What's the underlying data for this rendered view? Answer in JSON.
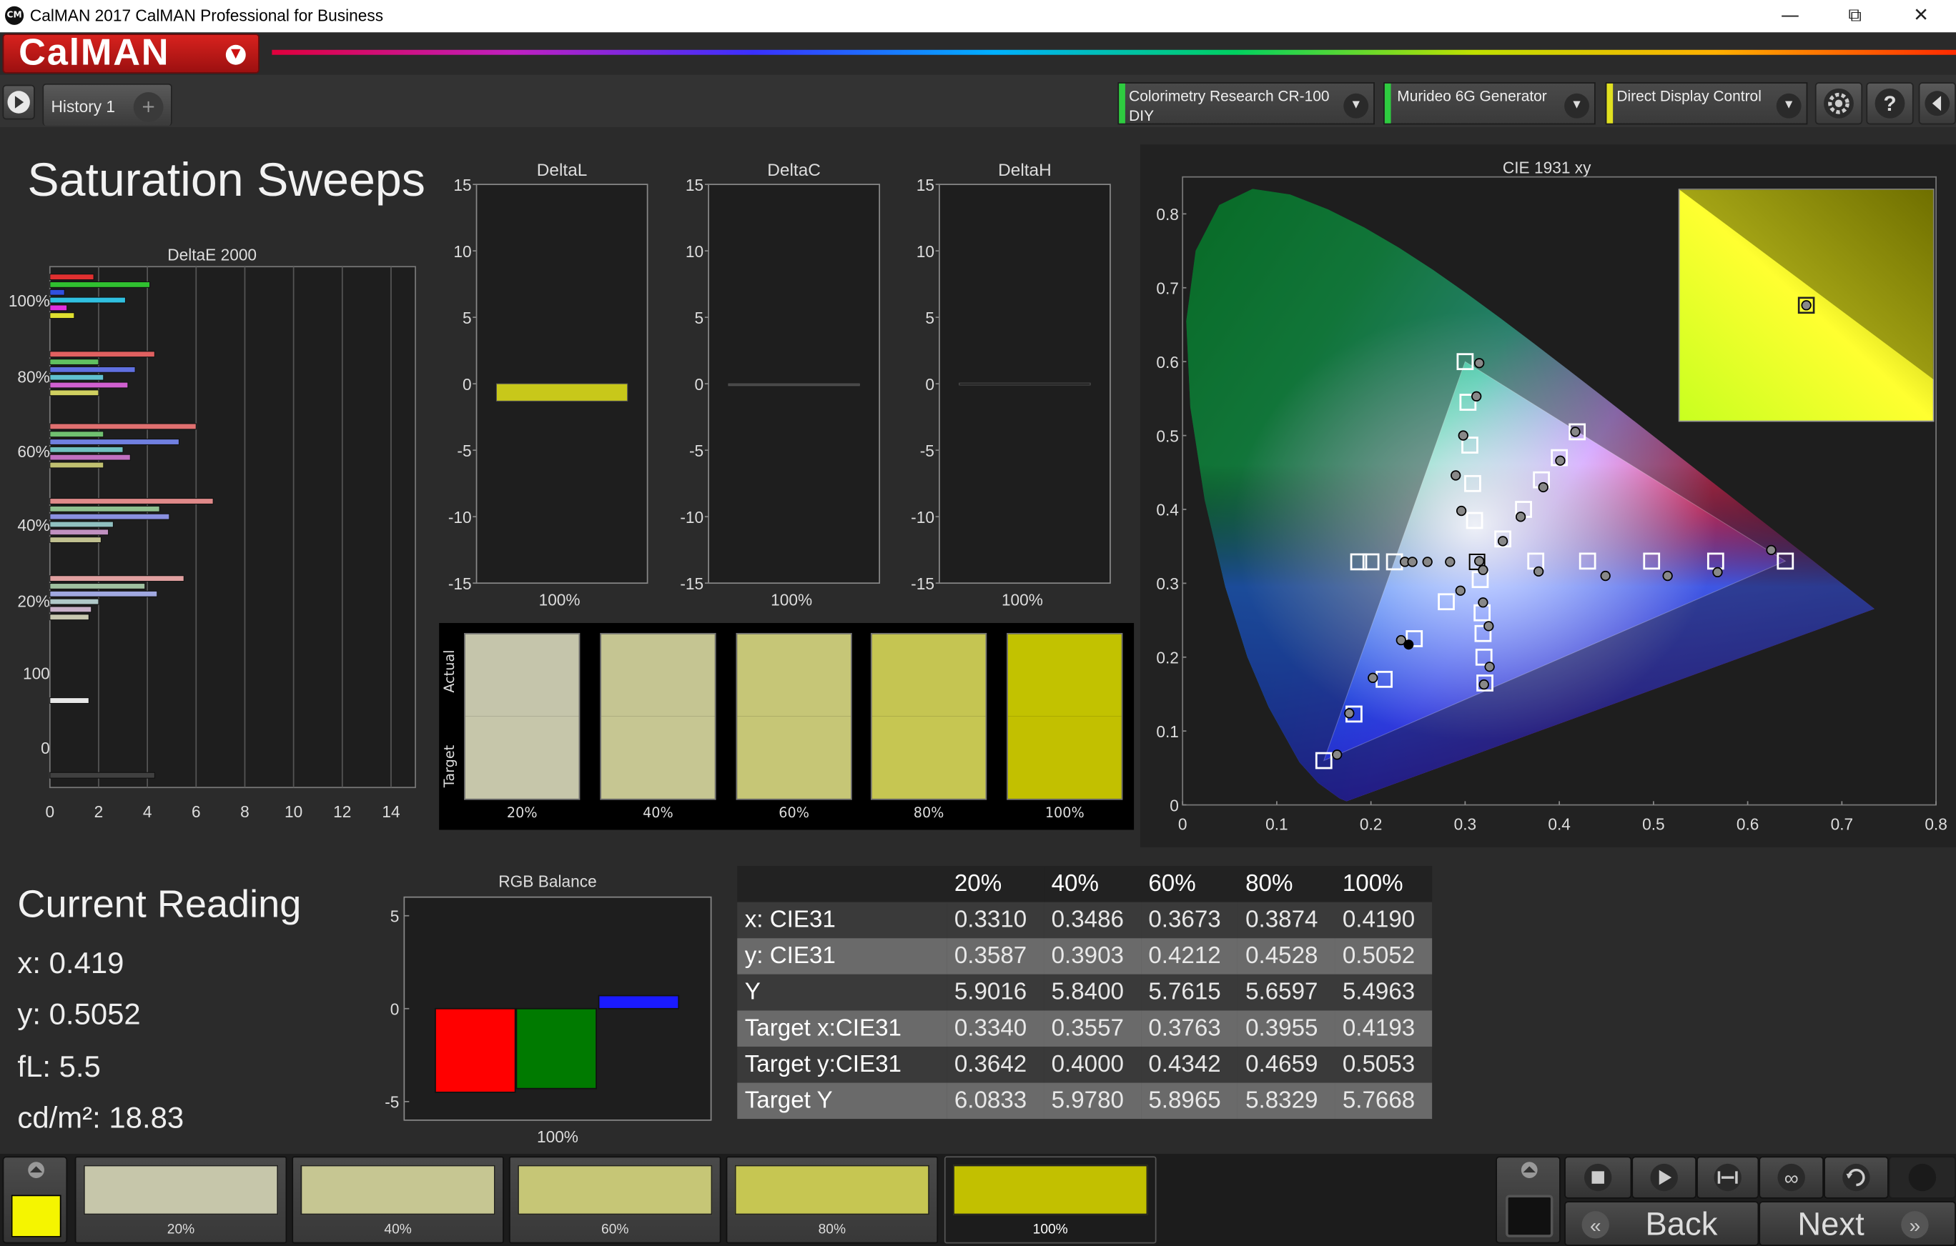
{
  "window": {
    "title": "CalMAN 2017 CalMAN Professional for Business",
    "app_icon": "CM"
  },
  "brand": {
    "logo": "CalMAN"
  },
  "tabs": [
    {
      "label": "History 1"
    }
  ],
  "devices": [
    {
      "label_line1": "Colorimetry Research CR-100",
      "label_line2": "DIY",
      "status_color": "#2ecc40"
    },
    {
      "label_line1": "Murideo 6G Generator",
      "label_line2": "",
      "status_color": "#2ecc40"
    },
    {
      "label_line1": "Direct Display Control",
      "label_line2": "",
      "status_color": "#e0e020"
    }
  ],
  "page": {
    "title": "Saturation Sweeps"
  },
  "deltae": {
    "title": "DeltaE 2000",
    "y_ticks": [
      "100%",
      "80%",
      "60%",
      "40%",
      "20%",
      "100",
      "0"
    ],
    "x_ticks": [
      "0",
      "2",
      "4",
      "6",
      "8",
      "10",
      "12",
      "14"
    ],
    "xlim": [
      0,
      15
    ],
    "groups": [
      {
        "label": "100%",
        "bars": [
          {
            "color": "#e03030",
            "value": 1.8
          },
          {
            "color": "#30c030",
            "value": 4.1
          },
          {
            "color": "#3050e0",
            "value": 0.6
          },
          {
            "color": "#30c0e0",
            "value": 3.1
          },
          {
            "color": "#e030e0",
            "value": 0.7
          },
          {
            "color": "#e0e030",
            "value": 1.0
          }
        ]
      },
      {
        "label": "80%",
        "bars": [
          {
            "color": "#e06060",
            "value": 4.3
          },
          {
            "color": "#60c060",
            "value": 2.0
          },
          {
            "color": "#6070e0",
            "value": 3.5
          },
          {
            "color": "#60c0d0",
            "value": 2.2
          },
          {
            "color": "#d060d0",
            "value": 3.2
          },
          {
            "color": "#d0d060",
            "value": 2.0
          }
        ]
      },
      {
        "label": "60%",
        "bars": [
          {
            "color": "#e07070",
            "value": 6.0
          },
          {
            "color": "#70c070",
            "value": 2.2
          },
          {
            "color": "#7080e0",
            "value": 5.3
          },
          {
            "color": "#70c0c0",
            "value": 3.0
          },
          {
            "color": "#c070c0",
            "value": 3.3
          },
          {
            "color": "#c0c070",
            "value": 2.2
          }
        ]
      },
      {
        "label": "40%",
        "bars": [
          {
            "color": "#e08a8a",
            "value": 6.7
          },
          {
            "color": "#90c090",
            "value": 4.5
          },
          {
            "color": "#8a90e0",
            "value": 4.9
          },
          {
            "color": "#90c0c0",
            "value": 2.6
          },
          {
            "color": "#c090c0",
            "value": 2.4
          },
          {
            "color": "#c0c090",
            "value": 2.1
          }
        ]
      },
      {
        "label": "20%",
        "bars": [
          {
            "color": "#e0a0a0",
            "value": 5.5
          },
          {
            "color": "#a0c0a0",
            "value": 3.9
          },
          {
            "color": "#a0a8e0",
            "value": 4.4
          },
          {
            "color": "#b0c8c8",
            "value": 2.0
          },
          {
            "color": "#c8b0c8",
            "value": 1.7
          },
          {
            "color": "#c8c8b0",
            "value": 1.6
          }
        ]
      },
      {
        "label": "100",
        "bars": [
          {
            "color": "#e8e8e8",
            "value": 1.6
          }
        ]
      },
      {
        "label": "0",
        "bars": [
          {
            "color": "#404040",
            "value": 4.3
          }
        ]
      }
    ]
  },
  "delta_charts": [
    {
      "title": "DeltaL",
      "category": "100%",
      "value": -1.3,
      "color": "#c8c81a",
      "ylim": [
        -15,
        15
      ],
      "y_ticks": [
        "15",
        "10",
        "5",
        "0",
        "-5",
        "-10",
        "-15"
      ]
    },
    {
      "title": "DeltaC",
      "category": "100%",
      "value": 0.0,
      "color": "#444444",
      "ylim": [
        -15,
        15
      ],
      "y_ticks": [
        "15",
        "10",
        "5",
        "0",
        "-5",
        "-10",
        "-15"
      ]
    },
    {
      "title": "DeltaH",
      "category": "100%",
      "value": 0.05,
      "color": "#111111",
      "ylim": [
        -15,
        15
      ],
      "y_ticks": [
        "15",
        "10",
        "5",
        "0",
        "-5",
        "-10",
        "-15"
      ]
    }
  ],
  "swatch_compare": {
    "actual_label": "Actual",
    "target_label": "Target",
    "items": [
      {
        "label": "20%",
        "actual": "#c5c5ab",
        "target": "#c6c6aa"
      },
      {
        "label": "40%",
        "actual": "#c5c592",
        "target": "#c6c692"
      },
      {
        "label": "60%",
        "actual": "#c6c677",
        "target": "#c6c676"
      },
      {
        "label": "80%",
        "actual": "#c5c552",
        "target": "#c6c652"
      },
      {
        "label": "100%",
        "actual": "#c2c200",
        "target": "#c2c000"
      }
    ]
  },
  "cie": {
    "title": "CIE 1931 xy",
    "x_ticks": [
      "0",
      "0.1",
      "0.2",
      "0.3",
      "0.4",
      "0.5",
      "0.6",
      "0.7",
      "0.8"
    ],
    "y_ticks": [
      "0",
      "0.1",
      "0.2",
      "0.3",
      "0.4",
      "0.5",
      "0.6",
      "0.7",
      "0.8"
    ],
    "xlim": [
      0,
      0.8
    ],
    "ylim": [
      0,
      0.85
    ],
    "gamut": [
      [
        0.64,
        0.33
      ],
      [
        0.3,
        0.6
      ],
      [
        0.15,
        0.06
      ]
    ],
    "targets": [
      [
        0.3127,
        0.329
      ],
      [
        0.64,
        0.33
      ],
      [
        0.566,
        0.33
      ],
      [
        0.498,
        0.33
      ],
      [
        0.43,
        0.33
      ],
      [
        0.375,
        0.33
      ],
      [
        0.3,
        0.6
      ],
      [
        0.303,
        0.545
      ],
      [
        0.305,
        0.487
      ],
      [
        0.308,
        0.435
      ],
      [
        0.31,
        0.385
      ],
      [
        0.15,
        0.06
      ],
      [
        0.182,
        0.123
      ],
      [
        0.214,
        0.17
      ],
      [
        0.246,
        0.225
      ],
      [
        0.28,
        0.275
      ],
      [
        0.225,
        0.329
      ],
      [
        0.2,
        0.329
      ],
      [
        0.187,
        0.329
      ],
      [
        0.316,
        0.305
      ],
      [
        0.318,
        0.26
      ],
      [
        0.319,
        0.232
      ],
      [
        0.32,
        0.2
      ],
      [
        0.321,
        0.165
      ],
      [
        0.419,
        0.505
      ],
      [
        0.4,
        0.47
      ],
      [
        0.381,
        0.44
      ],
      [
        0.362,
        0.4
      ],
      [
        0.34,
        0.36
      ]
    ],
    "measured": [
      [
        0.315,
        0.33
      ],
      [
        0.625,
        0.345
      ],
      [
        0.568,
        0.315
      ],
      [
        0.515,
        0.31
      ],
      [
        0.449,
        0.31
      ],
      [
        0.378,
        0.316
      ],
      [
        0.315,
        0.598
      ],
      [
        0.312,
        0.553
      ],
      [
        0.298,
        0.5
      ],
      [
        0.29,
        0.446
      ],
      [
        0.296,
        0.398
      ],
      [
        0.164,
        0.068
      ],
      [
        0.177,
        0.124
      ],
      [
        0.202,
        0.172
      ],
      [
        0.232,
        0.223
      ],
      [
        0.236,
        0.329
      ],
      [
        0.244,
        0.329
      ],
      [
        0.26,
        0.329
      ],
      [
        0.284,
        0.329
      ],
      [
        0.295,
        0.29
      ],
      [
        0.319,
        0.318
      ],
      [
        0.319,
        0.274
      ],
      [
        0.325,
        0.242
      ],
      [
        0.326,
        0.187
      ],
      [
        0.32,
        0.163
      ],
      [
        0.417,
        0.505
      ],
      [
        0.401,
        0.466
      ],
      [
        0.383,
        0.43
      ],
      [
        0.359,
        0.39
      ],
      [
        0.34,
        0.357
      ]
    ],
    "current": [
      0.24,
      0.217
    ],
    "inset": {
      "target": [
        0.4193,
        0.5053
      ],
      "measured": [
        0.419,
        0.5052
      ]
    }
  },
  "current_reading": {
    "title": "Current Reading",
    "lines": [
      "x: 0.419",
      "y: 0.5052",
      "fL: 5.5",
      "cd/m²: 18.83"
    ]
  },
  "rgb_balance": {
    "title": "RGB Balance",
    "category": "100%",
    "ylim": [
      -6,
      6
    ],
    "y_ticks": [
      "5",
      "0",
      "-5"
    ],
    "bars": [
      {
        "name": "R",
        "color": "#ff0000",
        "value": -4.5
      },
      {
        "name": "G",
        "color": "#007a00",
        "value": -4.3
      },
      {
        "name": "B",
        "color": "#1a1aff",
        "value": 0.7
      }
    ]
  },
  "table": {
    "columns": [
      "",
      "20%",
      "40%",
      "60%",
      "80%",
      "100%"
    ],
    "rows": [
      [
        "x: CIE31",
        "0.3310",
        "0.3486",
        "0.3673",
        "0.3874",
        "0.4190"
      ],
      [
        "y: CIE31",
        "0.3587",
        "0.3903",
        "0.4212",
        "0.4528",
        "0.5052"
      ],
      [
        "Y",
        "5.9016",
        "5.8400",
        "5.7615",
        "5.6597",
        "5.4963"
      ],
      [
        "Target x:CIE31",
        "0.3340",
        "0.3557",
        "0.3763",
        "0.3955",
        "0.4193"
      ],
      [
        "Target y:CIE31",
        "0.3642",
        "0.4000",
        "0.4342",
        "0.4659",
        "0.5053"
      ],
      [
        "Target Y",
        "6.0833",
        "5.9780",
        "5.8965",
        "5.8329",
        "5.7668"
      ]
    ]
  },
  "bottom_swatches": [
    {
      "label": "20%",
      "color": "#c6c6aa"
    },
    {
      "label": "40%",
      "color": "#c6c692"
    },
    {
      "label": "60%",
      "color": "#c6c676"
    },
    {
      "label": "80%",
      "color": "#c6c652"
    },
    {
      "label": "100%",
      "color": "#c2c000"
    }
  ],
  "current_swatch_color": "#f5f500",
  "nav": {
    "back": "Back",
    "next": "Next"
  }
}
